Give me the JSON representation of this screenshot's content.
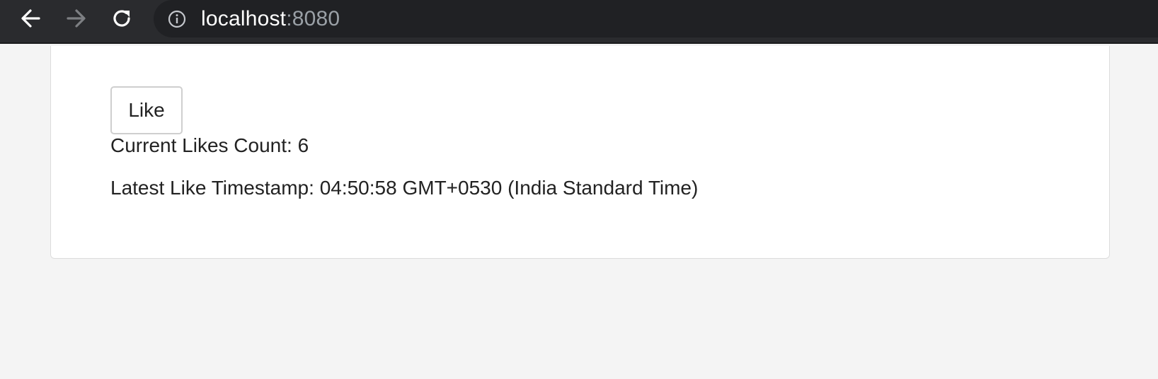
{
  "browser": {
    "url_host": "localhost",
    "url_port": ":8080",
    "icons": {
      "back": "arrow-left-icon",
      "forward": "arrow-right-icon",
      "reload": "reload-icon",
      "info": "info-icon"
    }
  },
  "app": {
    "like_button_label": "Like",
    "likes_count_label": "Current Likes Count:",
    "likes_count": "6",
    "timestamp_label": "Latest Like Timestamp:",
    "timestamp_value": "04:50:58 GMT+0530 (India Standard Time)"
  },
  "colors": {
    "browser_bar": "#2a2b2e",
    "omnibox": "#202124",
    "page_background": "#f4f4f4",
    "card_background": "#ffffff"
  }
}
